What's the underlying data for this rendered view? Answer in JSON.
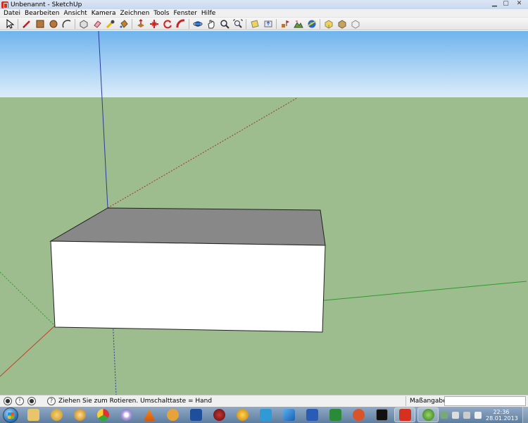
{
  "window": {
    "title": "Unbenannt - SketchUp"
  },
  "menu": {
    "items": [
      "Datei",
      "Bearbeiten",
      "Ansicht",
      "Kamera",
      "Zeichnen",
      "Tools",
      "Fenster",
      "Hilfe"
    ]
  },
  "toolbar": {
    "groups": [
      [
        "select-icon"
      ],
      [
        "pencil-line-icon",
        "rectangle-icon",
        "circle-icon",
        "arc-icon"
      ],
      [
        "make-component-icon",
        "eraser-icon",
        "tape-measure-icon",
        "paint-bucket-icon"
      ],
      [
        "push-pull-icon",
        "move-icon",
        "rotate-icon",
        "follow-me-icon"
      ],
      [
        "orbit-icon",
        "pan-icon",
        "zoom-icon",
        "zoom-extents-icon"
      ],
      [
        "get-models-icon",
        "share-model-icon"
      ],
      [
        "add-location-icon",
        "terrain-icon",
        "google-earth-icon"
      ],
      [
        "get-components-icon",
        "share-component-icon",
        "extension-warehouse-icon"
      ]
    ]
  },
  "status": {
    "text": "Ziehen Sie zum Rotieren.  Umschalttaste = Hand",
    "measurements_label": "Maßangaben",
    "measurements_value": ""
  },
  "taskbar": {
    "apps": [
      "explorer-icon",
      "browser-icon",
      "media-icon",
      "chrome-icon",
      "disc-icon",
      "vlc-icon",
      "app-icon",
      "pd-icon",
      "paint-icon",
      "game-icon",
      "files-icon",
      "movie-icon",
      "word-icon",
      "excel-icon",
      "fox-icon",
      "terminal-icon",
      "sketchup-icon",
      "xbox-icon"
    ],
    "active_app": "sketchup-icon",
    "clock_time": "22:36",
    "clock_date": "28.01.2013"
  },
  "colors": {
    "sky_top": "#6fb4ee",
    "sky_bottom": "#dcecfa",
    "ground": "#9dbd8f",
    "box_top": "#888888",
    "box_front": "#ffffff",
    "axis_red": "#c83b2a",
    "axis_green": "#2e9a2e",
    "axis_blue": "#2c3a9c"
  }
}
